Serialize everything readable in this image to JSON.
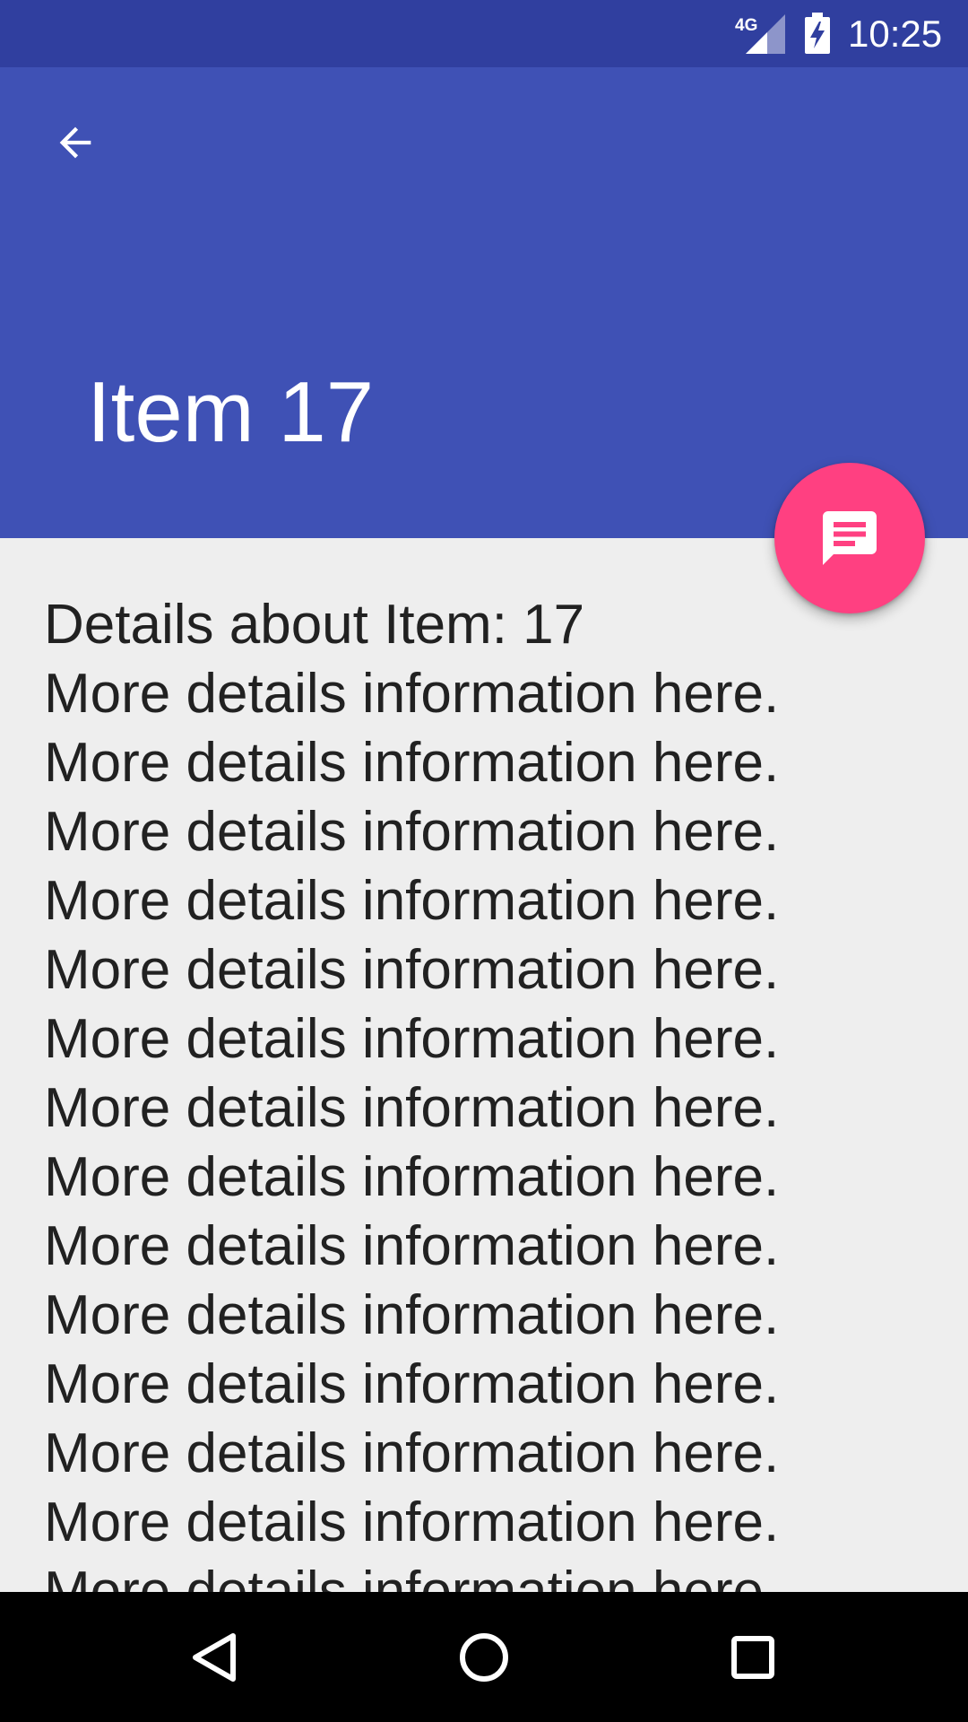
{
  "status_bar": {
    "network": "4G",
    "time": "10:25",
    "icons": [
      "signal-icon",
      "battery-charging-icon"
    ]
  },
  "app_bar": {
    "title": "Item 17",
    "back_icon": "arrow-back-icon",
    "color": "#3f51b5"
  },
  "content": {
    "heading": "Details about Item: 17",
    "lines": [
      "More details information here.",
      "More details information here.",
      "More details information here.",
      "More details information here.",
      "More details information here.",
      "More details information here.",
      "More details information here.",
      "More details information here.",
      "More details information here.",
      "More details information here.",
      "More details information here.",
      "More details information here.",
      "More details information here.",
      "More details information here."
    ]
  },
  "fab": {
    "icon": "message-icon",
    "color": "#ff4081"
  },
  "nav_bar": {
    "icons": [
      "nav-back-icon",
      "nav-home-icon",
      "nav-recents-icon"
    ]
  },
  "colors": {
    "primary_dark": "#303f9f",
    "primary": "#3f51b5",
    "accent": "#ff4081",
    "background": "#eeeeee",
    "text": "#212121"
  }
}
